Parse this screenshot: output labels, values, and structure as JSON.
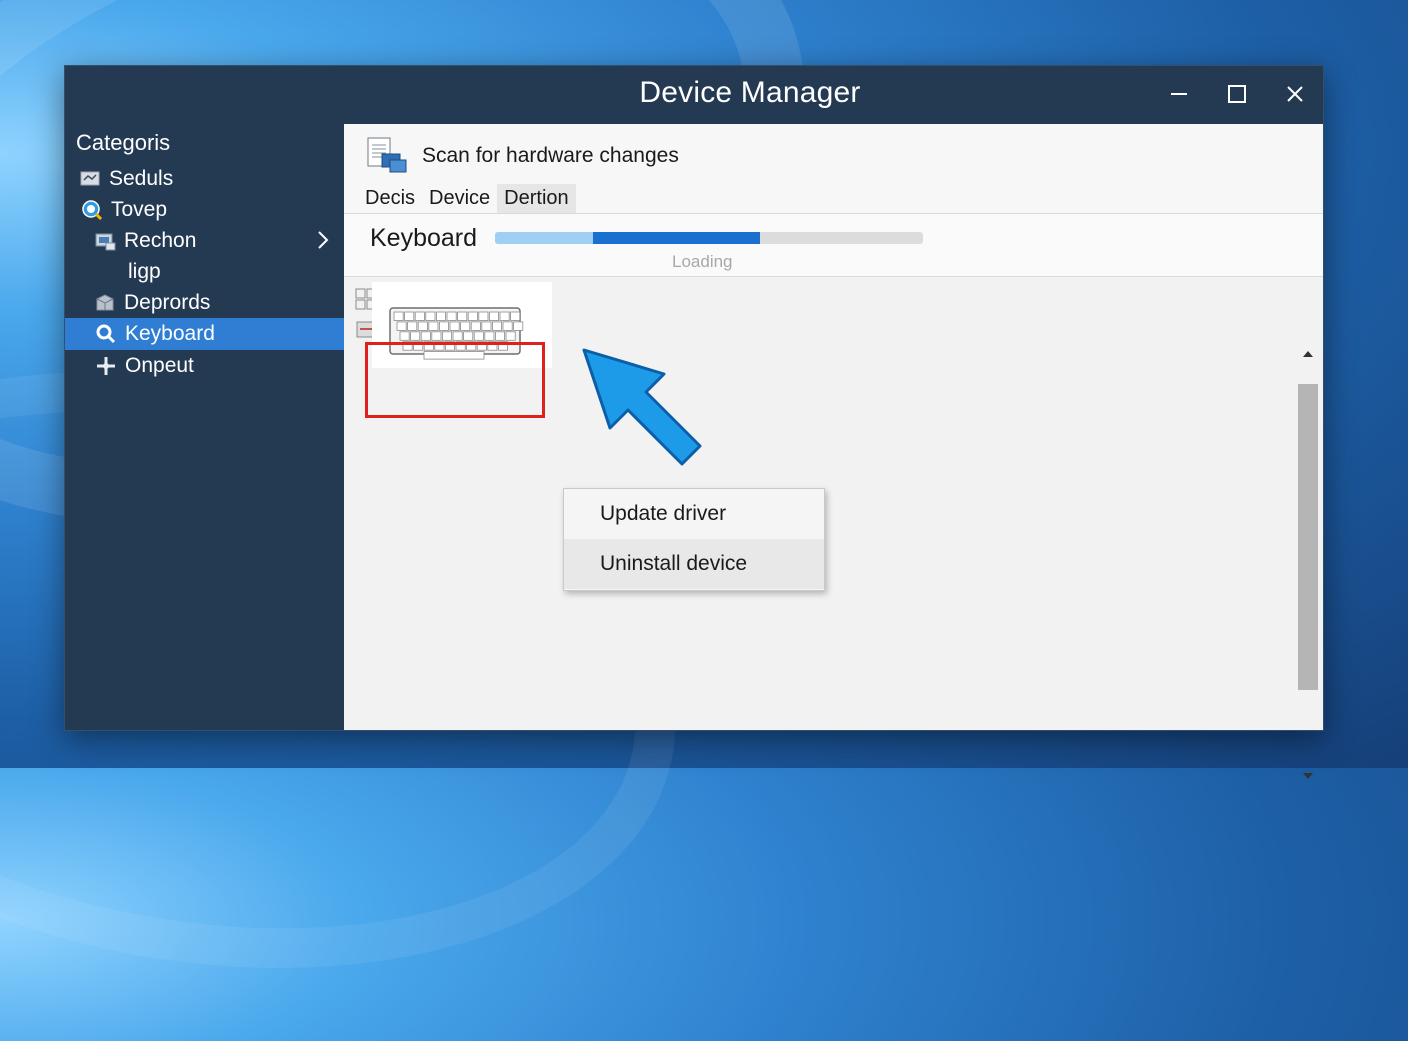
{
  "window": {
    "title": "Device Manager"
  },
  "sidebar": {
    "heading": "Categoris",
    "items": [
      {
        "label": "Seduls",
        "icon": "monitor-icon",
        "active": false
      },
      {
        "label": "Tovep",
        "icon": "search-globe-icon",
        "active": false
      },
      {
        "label": "Rechon",
        "icon": "network-icon",
        "active": false,
        "has_chevron": true
      },
      {
        "label": "ligp",
        "icon": "",
        "active": false
      },
      {
        "label": "Deprords",
        "icon": "box-icon",
        "active": false
      },
      {
        "label": "Keyboard",
        "icon": "magnifier-icon",
        "active": true
      },
      {
        "label": "Onpeut",
        "icon": "joystick-icon",
        "active": false
      }
    ]
  },
  "toolbar": {
    "scan_label": "Scan for hardware changes",
    "tabs": [
      "Decis",
      "Device",
      "Dertion"
    ],
    "selected_tab": "Dertion"
  },
  "device": {
    "label": "Keyboard",
    "loading_text": "Loading",
    "progress_light": 0.23,
    "progress_dark_end": 0.62
  },
  "context_menu": {
    "items": [
      "Update driver",
      "Uninstall device"
    ],
    "hovered_index": 1
  },
  "colors": {
    "accent": "#2f7ed4",
    "highlight_border": "#e0201c",
    "arrow": "#1e9be8"
  }
}
